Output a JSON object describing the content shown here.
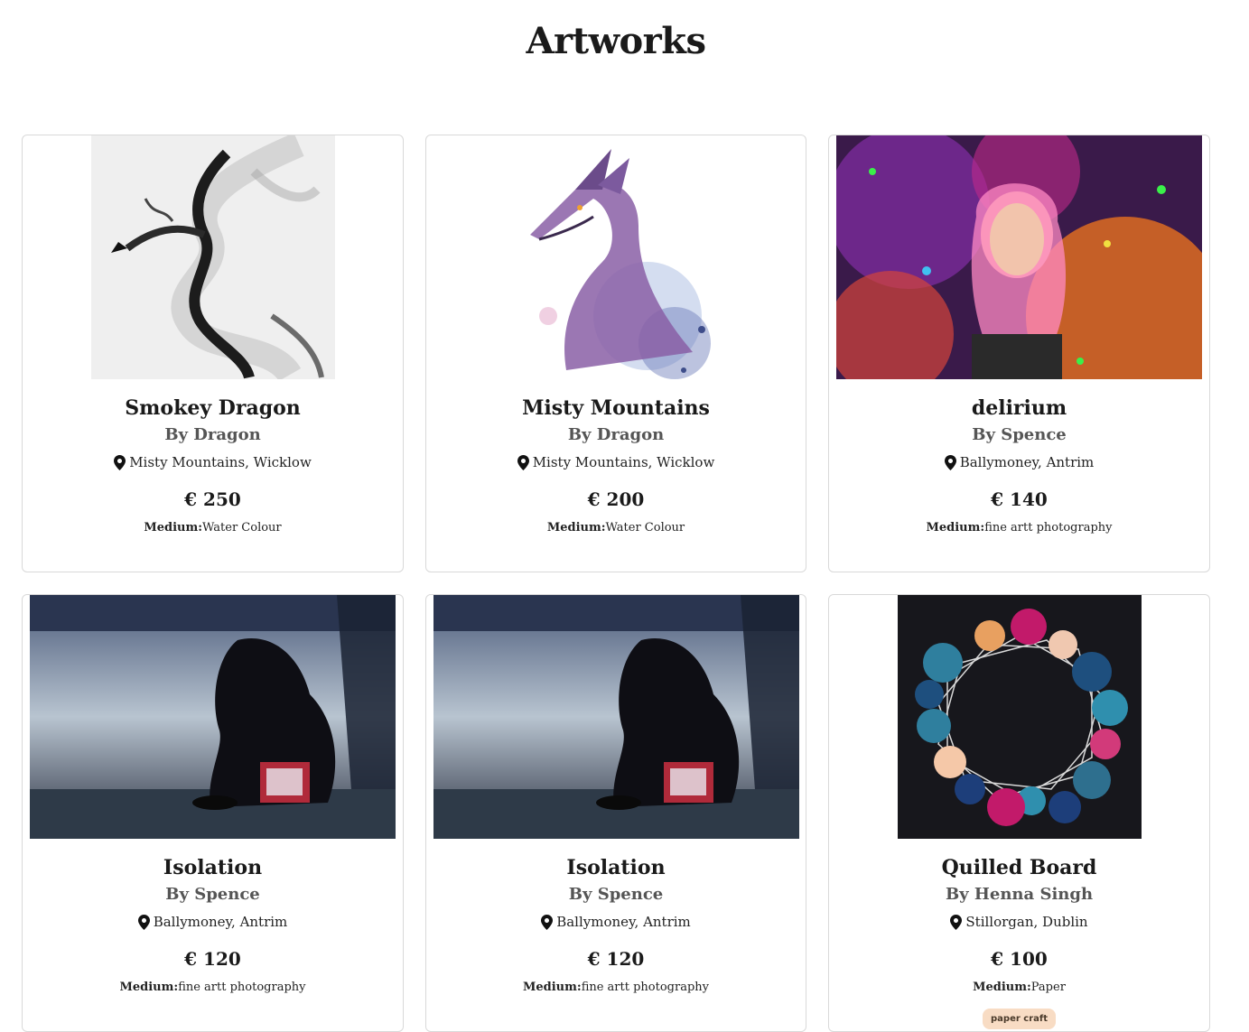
{
  "page": {
    "title": "Artworks"
  },
  "artworks": [
    {
      "title": "Smokey Dragon",
      "artist": "By Dragon",
      "location": "Misty Mountains, Wicklow",
      "price": "€ 250",
      "medium_label": "Medium:",
      "medium": "Water Colour",
      "image": "smoke-dragon-image"
    },
    {
      "title": "Misty Mountains",
      "artist": "By Dragon",
      "location": "Misty Mountains, Wicklow",
      "price": "€ 200",
      "medium_label": "Medium:",
      "medium": "Water Colour",
      "image": "watercolor-dragon-image"
    },
    {
      "title": "delirium",
      "artist": "By Spence",
      "location": "Ballymoney, Antrim",
      "price": "€ 140",
      "medium_label": "Medium:",
      "medium": "fine artt photography",
      "image": "psychedelic-portrait-image"
    },
    {
      "title": "Isolation",
      "artist": "By Spence",
      "location": "Ballymoney, Antrim",
      "price": "€ 120",
      "medium_label": "Medium:",
      "medium": "fine artt photography",
      "image": "hooded-figure-photo"
    },
    {
      "title": "Isolation",
      "artist": "By Spence",
      "location": "Ballymoney, Antrim",
      "price": "€ 120",
      "medium_label": "Medium:",
      "medium": "fine artt photography",
      "image": "hooded-figure-photo"
    },
    {
      "title": "Quilled Board",
      "artist": "By Henna Singh",
      "location": "Stillorgan, Dublin",
      "price": "€ 100",
      "medium_label": "Medium:",
      "medium": "Paper",
      "tag": "paper craft",
      "image": "quilled-flowers-image"
    }
  ],
  "colors": {
    "badge_bg": "#f8dcc4",
    "border": "#d9d9d9",
    "artist_text": "#555555"
  }
}
